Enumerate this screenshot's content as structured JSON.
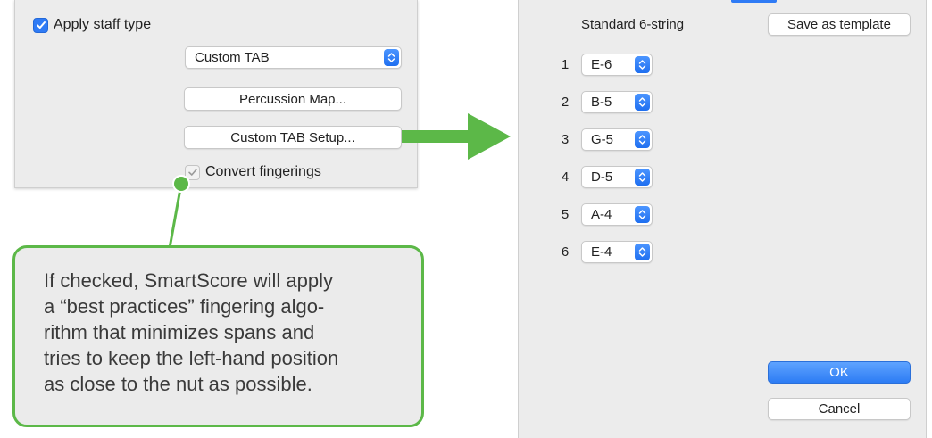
{
  "left_dialog": {
    "apply_staff_type": {
      "label": "Apply staff type",
      "checked": true
    },
    "staff_type_select": {
      "value": "Custom TAB"
    },
    "percussion_map_button": "Percussion Map...",
    "custom_tab_setup_button": "Custom TAB Setup...",
    "convert_fingerings": {
      "label": "Convert fingerings",
      "checked": true,
      "enabled": false
    }
  },
  "callout": {
    "text": "If checked, SmartScore will apply a “best practices” fingering algo-rithm that minimizes spans and tries to keep the left-hand position as close to the nut as possible.",
    "lines": [
      "If checked, SmartScore will apply",
      "a “best practices” fingering algo-",
      "rithm that minimizes spans and",
      "tries to keep the left-hand position",
      "as close to the nut as possible."
    ],
    "color": "#5cb848"
  },
  "right_dialog": {
    "string_set_name": "Standard 6-string",
    "save_as_template_button": "Save as template",
    "strings": [
      {
        "number": "1",
        "tuning": "E-6"
      },
      {
        "number": "2",
        "tuning": "B-5"
      },
      {
        "number": "3",
        "tuning": "G-5"
      },
      {
        "number": "4",
        "tuning": "D-5"
      },
      {
        "number": "5",
        "tuning": "A-4"
      },
      {
        "number": "6",
        "tuning": "E-4"
      }
    ],
    "ok_button": "OK",
    "cancel_button": "Cancel"
  },
  "colors": {
    "accent_blue": "#2f7bf5",
    "callout_green": "#5cb848",
    "panel_gray": "#ececec"
  },
  "icons": {
    "checkbox_check": "checkmark-icon",
    "popup_stepper": "up-down-chevron-icon",
    "pointer_arrow": "right-arrow-icon"
  }
}
